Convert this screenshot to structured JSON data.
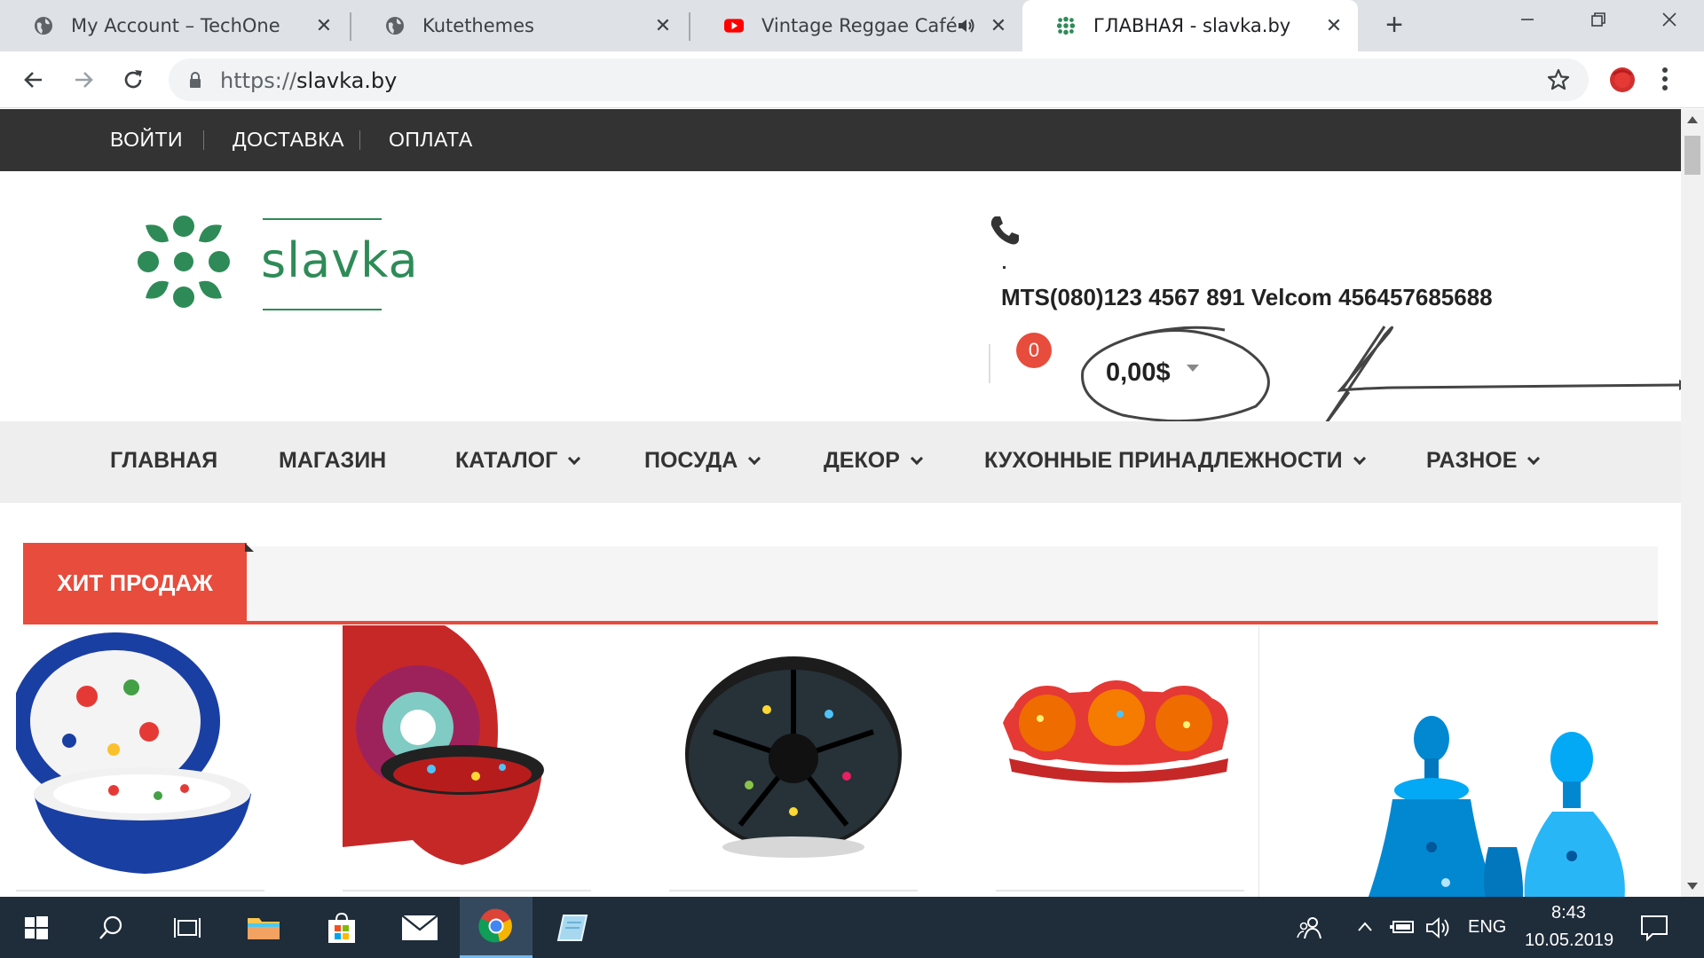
{
  "browser": {
    "tabs": [
      {
        "title": "My Account – TechOne",
        "icon": "globe-icon"
      },
      {
        "title": "Kutethemes",
        "icon": "globe-icon"
      },
      {
        "title": "Vintage Reggae Café Vol",
        "icon": "youtube-icon"
      },
      {
        "title": "ГЛАВНАЯ - slavka.by",
        "icon": "slavka-favicon"
      }
    ],
    "close_glyph": "✕",
    "new_tab_glyph": "+",
    "url_scheme": "https://",
    "url_host": "slavka.by"
  },
  "site": {
    "topbar_links": [
      "ВОЙТИ",
      "ДОСТАВКА",
      "ОПЛАТА"
    ],
    "logo_text": "slavka",
    "phone": "MTS(080)123 4567 891 Velcom 456457685688",
    "cart_count": "0",
    "cart_total": "0,00$",
    "nav": [
      {
        "label": "ГЛАВНАЯ",
        "dropdown": false
      },
      {
        "label": "МАГАЗИН",
        "dropdown": false
      },
      {
        "label": "КАТАЛОГ",
        "dropdown": true
      },
      {
        "label": "ПОСУДА",
        "dropdown": true
      },
      {
        "label": "ДЕКОР",
        "dropdown": true
      },
      {
        "label": "КУХОННЫЕ ПРИНАДЛЕЖНОСТИ",
        "dropdown": true
      },
      {
        "label": "РАЗНОЕ",
        "dropdown": true
      }
    ],
    "section_title": "ХИТ ПРОДАЖ",
    "colors": {
      "brand_green": "#2e8b57",
      "accent_red": "#e74c3c",
      "topbar": "#333333"
    }
  },
  "taskbar": {
    "language": "ENG",
    "time": "8:43",
    "date": "10.05.2019"
  }
}
